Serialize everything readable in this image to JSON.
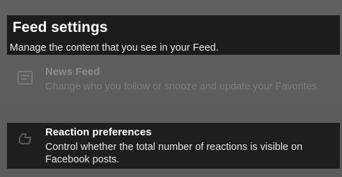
{
  "header": {
    "title": "Feed settings",
    "subtitle": "Manage the content that you see in your Feed."
  },
  "items": [
    {
      "title": "News Feed",
      "description": "Change who you follow or snooze and update your Favorites.",
      "icon": "news-feed-icon"
    },
    {
      "title": "Reaction preferences",
      "description": "Control whether the total number of reactions is visible on Facebook posts.",
      "icon": "reaction-icon"
    }
  ],
  "colors": {
    "overlay": "#5a5b5e",
    "panel": "#1b1c1f",
    "text_primary": "#ffffff",
    "text_dimmed": "#8a8b8e"
  }
}
